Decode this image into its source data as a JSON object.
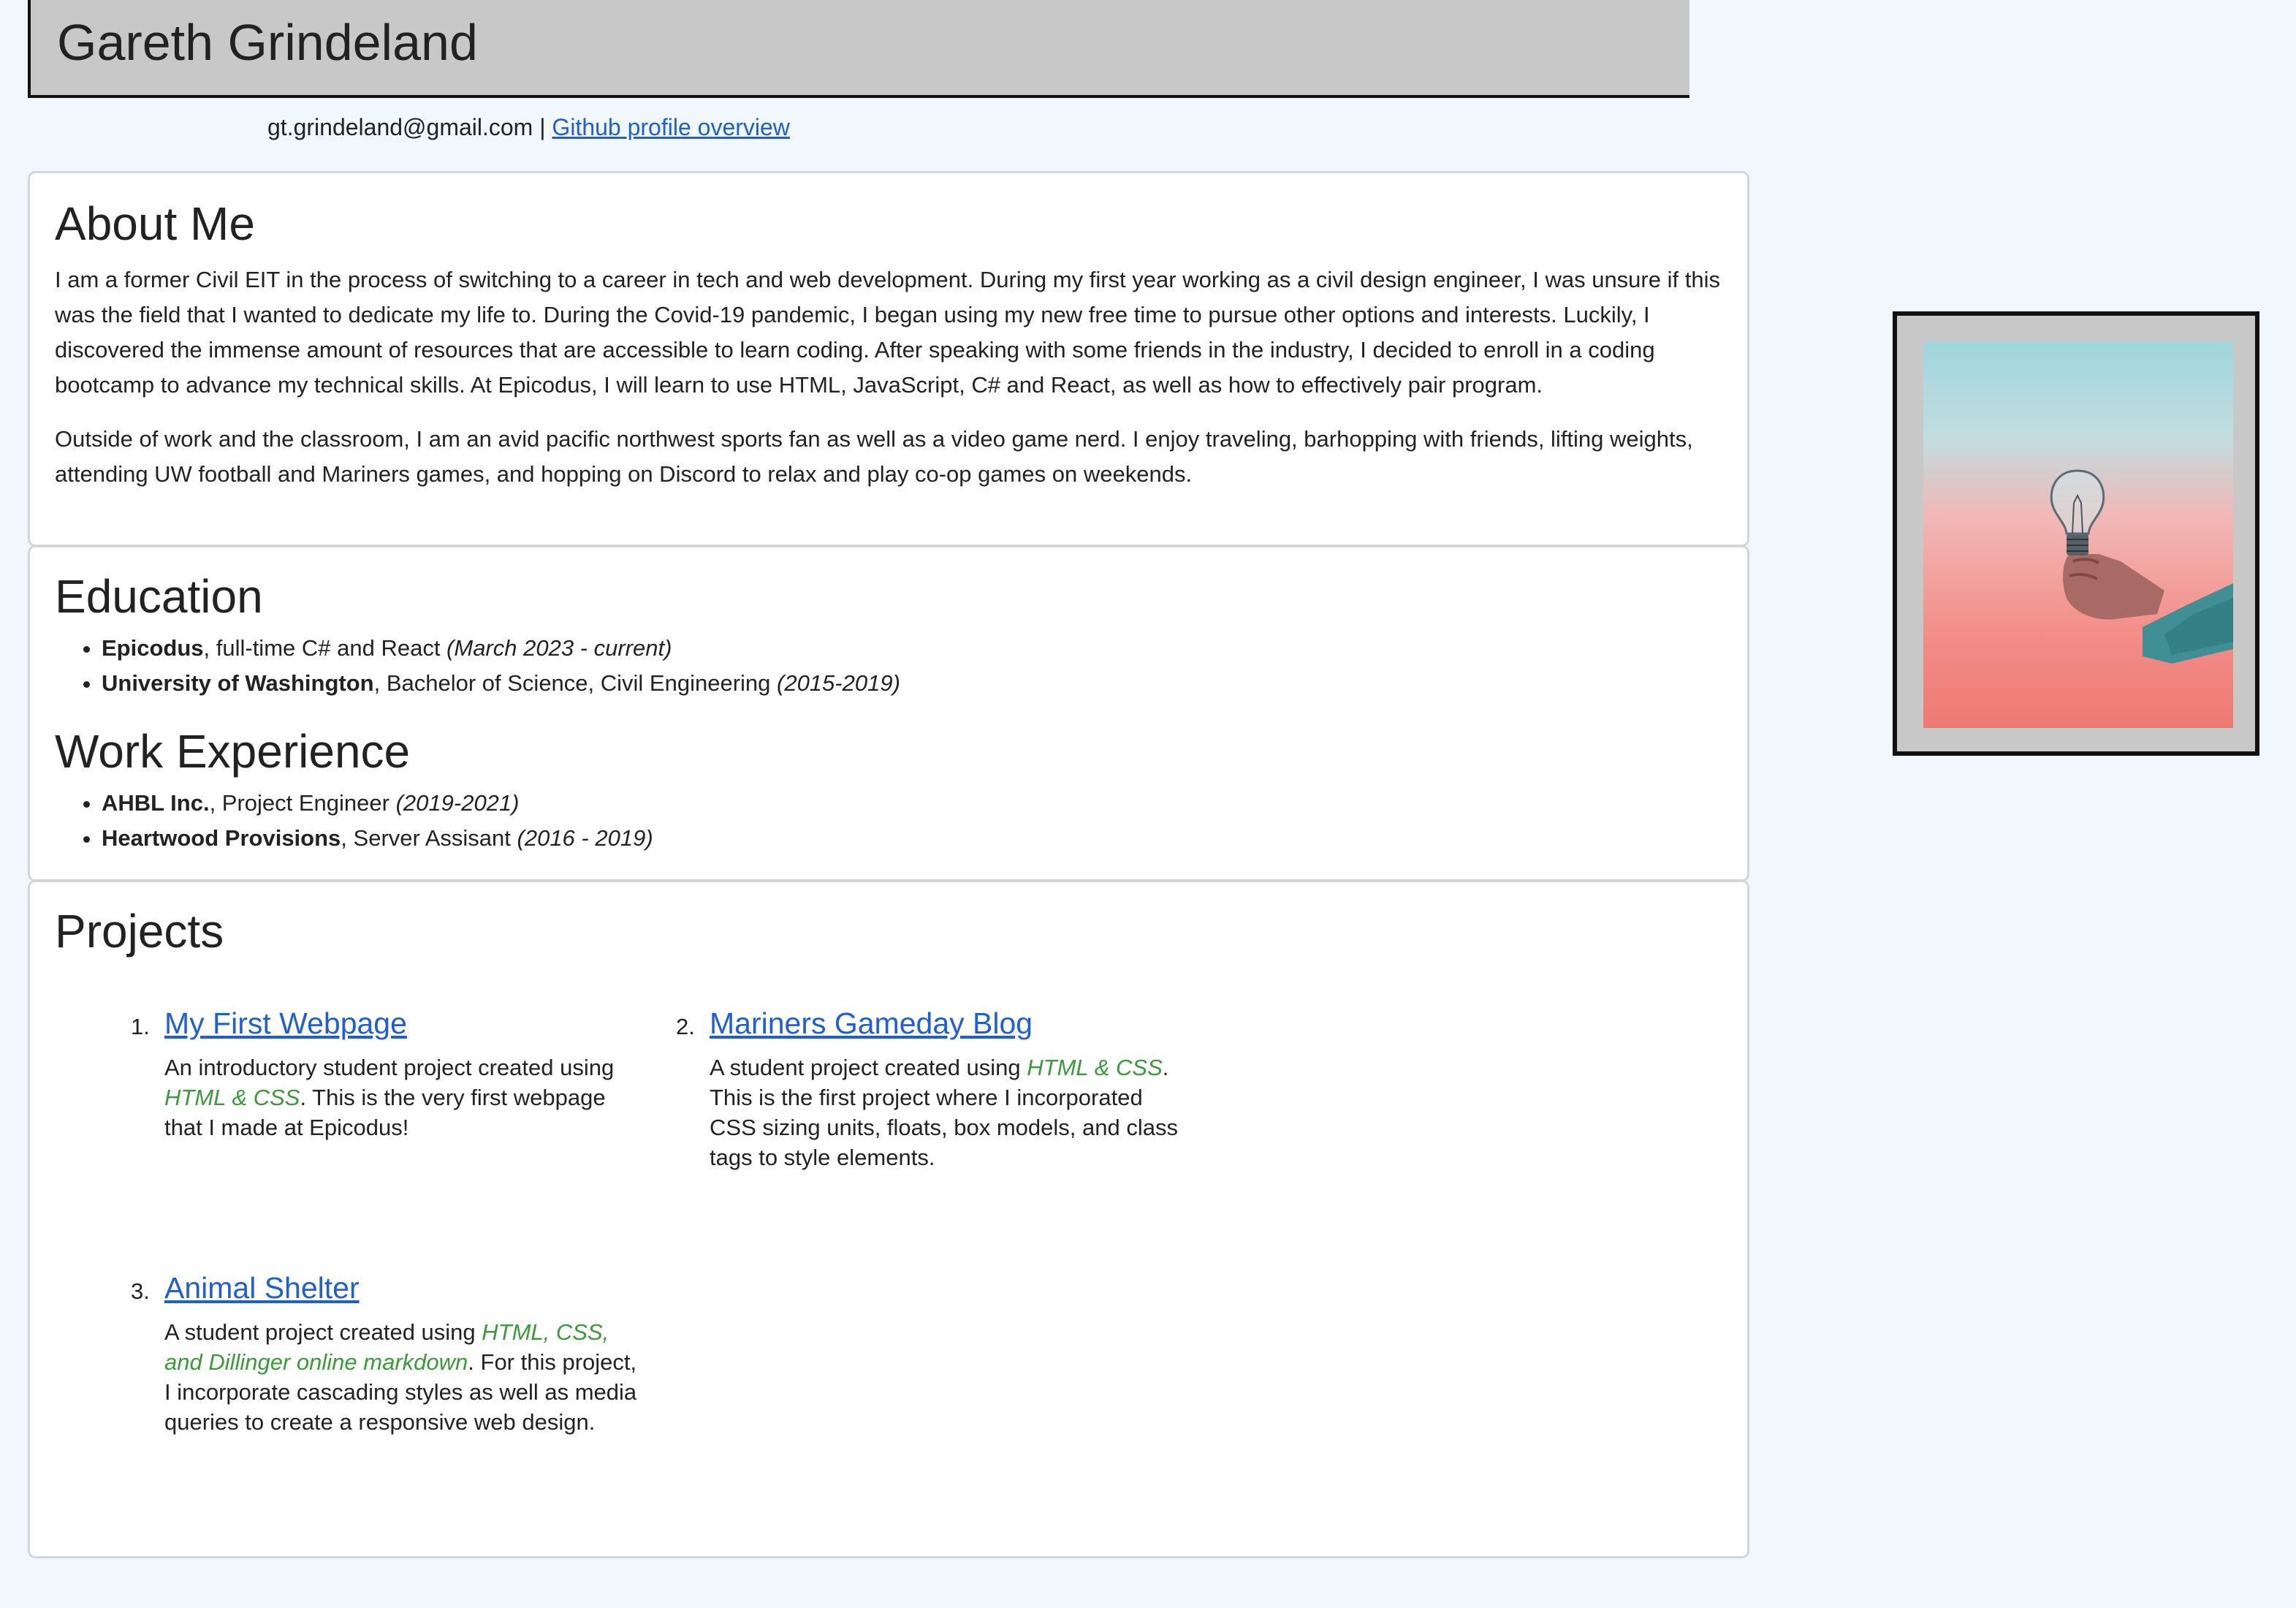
{
  "header": {
    "name": "Gareth Grindeland"
  },
  "contact": {
    "email": "gt.grindeland@gmail.com",
    "separator": "|",
    "github_label": "Github profile overview"
  },
  "about": {
    "title": "About Me",
    "p1": "I am a former Civil EIT in the process of switching to a career in tech and web development. During my first year working as a civil design engineer, I was unsure if this was the field that I wanted to dedicate my life to. During the Covid-19 pandemic, I began using my new free time to pursue other options and interests. Luckily, I discovered the immense amount of resources that are accessible to learn coding. After speaking with some friends in the industry, I decided to enroll in a coding bootcamp to advance my technical skills. At Epicodus, I will learn to use HTML, JavaScript, C# and React, as well as how to effectively pair program.",
    "p2": "Outside of work and the classroom, I am an avid pacific northwest sports fan as well as a video game nerd. I enjoy traveling, barhopping with friends, lifting weights, attending UW football and Mariners games, and hopping on Discord to relax and play co-op games on weekends."
  },
  "education": {
    "title": "Education",
    "items": [
      {
        "name": "Epicodus",
        "detail": ", full-time C# and React ",
        "dates": "(March 2023 - current)"
      },
      {
        "name": "University of Washington",
        "detail": ", Bachelor of Science, Civil Engineering ",
        "dates": "(2015-2019)"
      }
    ]
  },
  "work": {
    "title": "Work Experience",
    "items": [
      {
        "name": "AHBL Inc.",
        "detail": ", Project Engineer ",
        "dates": "(2019-2021)"
      },
      {
        "name": "Heartwood Provisions",
        "detail": ", Server Assisant ",
        "dates": "(2016 - 2019)"
      }
    ]
  },
  "projects": {
    "title": "Projects",
    "items": [
      {
        "num": "1.",
        "title": "My First Webpage",
        "pre": "An introductory student project created using ",
        "tech": "HTML & CSS",
        "post": ". This is the very first webpage that I made at Epicodus!"
      },
      {
        "num": "2.",
        "title": "Mariners Gameday Blog",
        "pre": "A student project created using ",
        "tech": "HTML & CSS",
        "post": ". This is the first project where I incorporated CSS sizing units, floats, box models, and class tags to style elements."
      },
      {
        "num": "3.",
        "title": "Animal Shelter",
        "pre": "A student project created using ",
        "tech": "HTML, CSS, and Dillinger online markdown",
        "post": ". For this project, I incorporate cascading styles as well as media queries to create a responsive web design."
      }
    ]
  },
  "photo": {
    "subject": "hand-holding-lightbulb"
  }
}
